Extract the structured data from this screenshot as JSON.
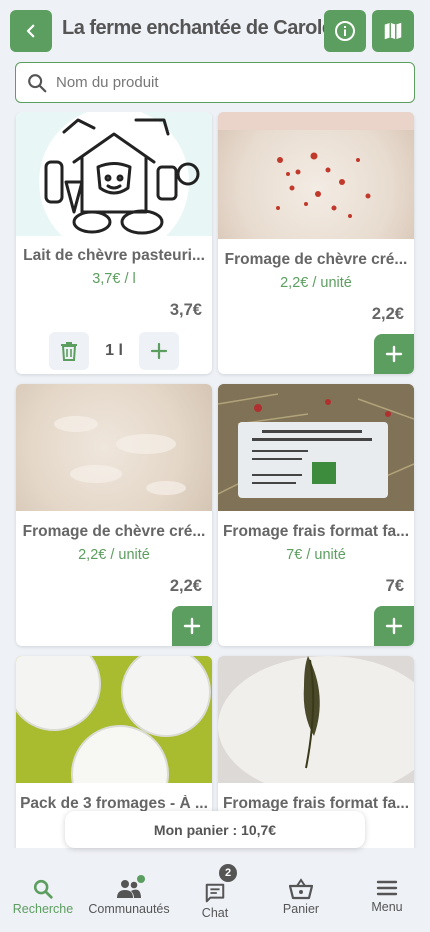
{
  "header": {
    "title": "La ferme enchantée de Carole",
    "back_icon": "chevron-left-icon",
    "info_icon": "info-icon",
    "map_icon": "map-icon"
  },
  "search": {
    "placeholder": "Nom du produit",
    "value": ""
  },
  "products": [
    {
      "name": "Lait de chèvre pasteuri...",
      "unit_price": "3,7€ /",
      "unit": "l",
      "price": "3,7€",
      "in_cart": true,
      "quantity": "1 l"
    },
    {
      "name": "Fromage de chèvre cré...",
      "unit_price": "2,2€ /",
      "unit": "unité",
      "price": "2,2€",
      "in_cart": false
    },
    {
      "name": "Fromage de chèvre cré...",
      "unit_price": "2,2€ /",
      "unit": "unité",
      "price": "2,2€",
      "in_cart": false
    },
    {
      "name": "Fromage frais format fa...",
      "unit_price": "7€ /",
      "unit": "unité",
      "price": "7€",
      "in_cart": false
    },
    {
      "name": "Pack de 3 fromages - À ...",
      "in_cart": false
    },
    {
      "name": "Fromage frais format fa...",
      "in_cart": false
    }
  ],
  "cart": {
    "label": "Mon panier : 10,7€"
  },
  "nav": [
    {
      "label": "Recherche",
      "icon": "search-icon",
      "active": true
    },
    {
      "label": "Communautés",
      "icon": "community-icon",
      "active": false
    },
    {
      "label": "Chat",
      "icon": "chat-icon",
      "badge": "2",
      "active": false
    },
    {
      "label": "Panier",
      "icon": "basket-icon",
      "active": false
    },
    {
      "label": "Menu",
      "icon": "menu-icon",
      "active": false
    }
  ],
  "colors": {
    "accent": "#5c9e5f",
    "background": "#eef1f6",
    "text": "#555555"
  }
}
